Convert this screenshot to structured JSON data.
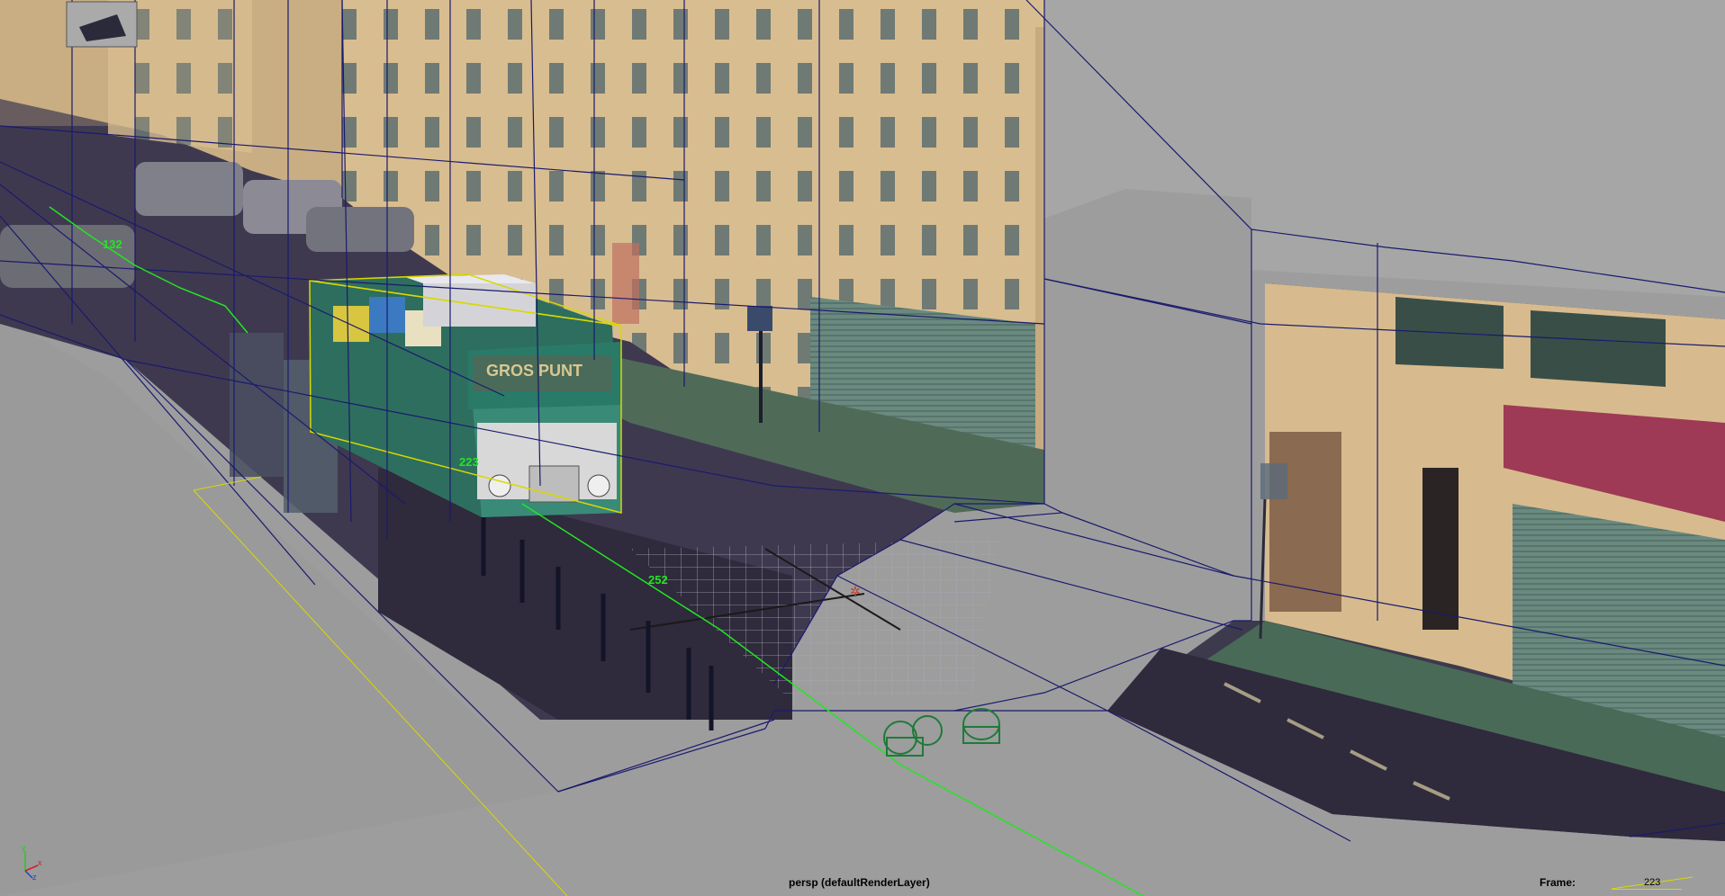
{
  "viewport": {
    "camera_label": "persp (defaultRenderLayer)",
    "frame_label": "Frame:",
    "frame_value": "223"
  },
  "path_labels": [
    "132",
    "223",
    "252"
  ],
  "axis_gizmo": {
    "x": "x",
    "y": "y",
    "z": "z"
  },
  "bus": {
    "destination_sign": "GROS PUNT"
  },
  "colors": {
    "background": "#9d9d9d",
    "wireframe": "#1a1a6e",
    "selection": "#d8d800",
    "path": "#22e622",
    "building": "#d9bf93",
    "street": "#3f3950"
  }
}
